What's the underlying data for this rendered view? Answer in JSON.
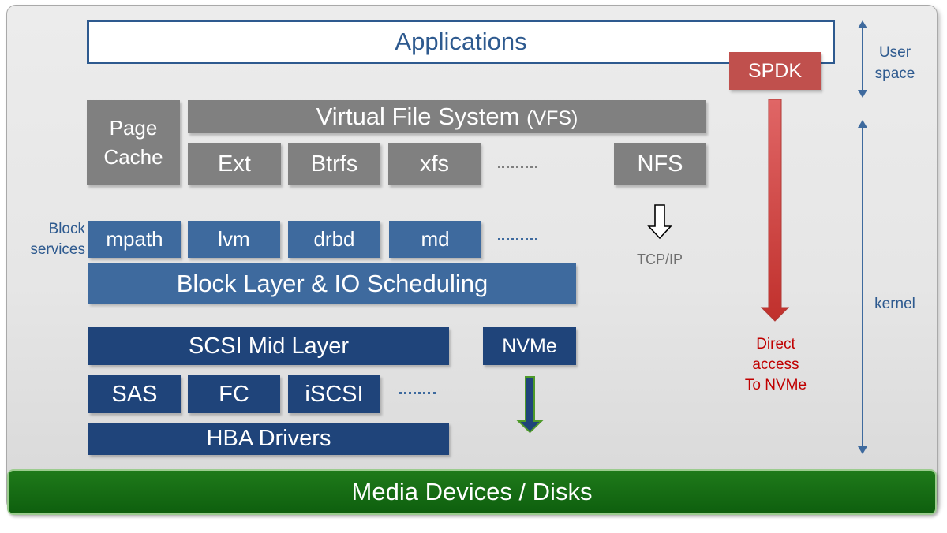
{
  "user_space_label": "User\nspace",
  "kernel_label": "kernel",
  "applications": "Applications",
  "spdk": "SPDK",
  "direct_access": "Direct\naccess\nTo NVMe",
  "page_cache": "Page\nCache",
  "vfs": {
    "main": "Virtual File System ",
    "abbr": "(VFS)"
  },
  "filesystems": [
    "Ext",
    "Btrfs",
    "xfs",
    "NFS"
  ],
  "block_services_label": "Block\nservices",
  "block_services": [
    "mpath",
    "lvm",
    "drbd",
    "md"
  ],
  "block_layer": "Block Layer & IO Scheduling",
  "tcpip": "TCP/IP",
  "scsi_mid": "SCSI Mid Layer",
  "nvme": "NVMe",
  "transports": [
    "SAS",
    "FC",
    "iSCSI"
  ],
  "hba": "HBA Drivers",
  "media": "Media Devices / Disks",
  "colors": {
    "gray": "#808080",
    "blue_mid": "#3e6a9e",
    "blue_dark": "#1f447a",
    "spdk_red": "#c0504d",
    "green": "#0e5f0e"
  }
}
